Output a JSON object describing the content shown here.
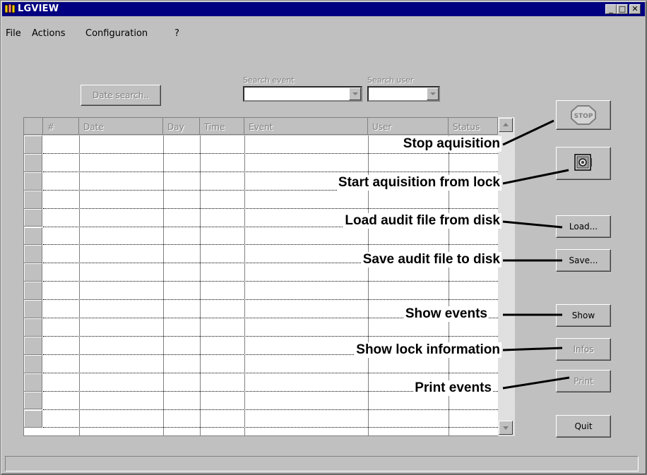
{
  "window": {
    "title": "LGVIEW"
  },
  "menu": [
    {
      "label": "File"
    },
    {
      "label": "Actions"
    },
    {
      "label": "Configuration"
    },
    {
      "label": "?"
    }
  ],
  "toolbar": {
    "date_search": "Date search..",
    "search_event_label": "Search event",
    "search_user_label": "Search user"
  },
  "table": {
    "columns": [
      "#",
      "Date",
      "Day",
      "Time",
      "Event",
      "User",
      "Status"
    ]
  },
  "buttons": {
    "stop": "STOP",
    "load": "Load...",
    "save": "Save...",
    "show": "Show",
    "infos": "Infos",
    "print": "Print",
    "quit": "Quit"
  },
  "annotations": {
    "stop": "Stop aquisition",
    "start": "Start aquisition from lock",
    "load": "Load audit file from disk",
    "save": "Save audit file to disk",
    "show": "Show events",
    "infos": "Show lock information",
    "print": "Print events"
  }
}
